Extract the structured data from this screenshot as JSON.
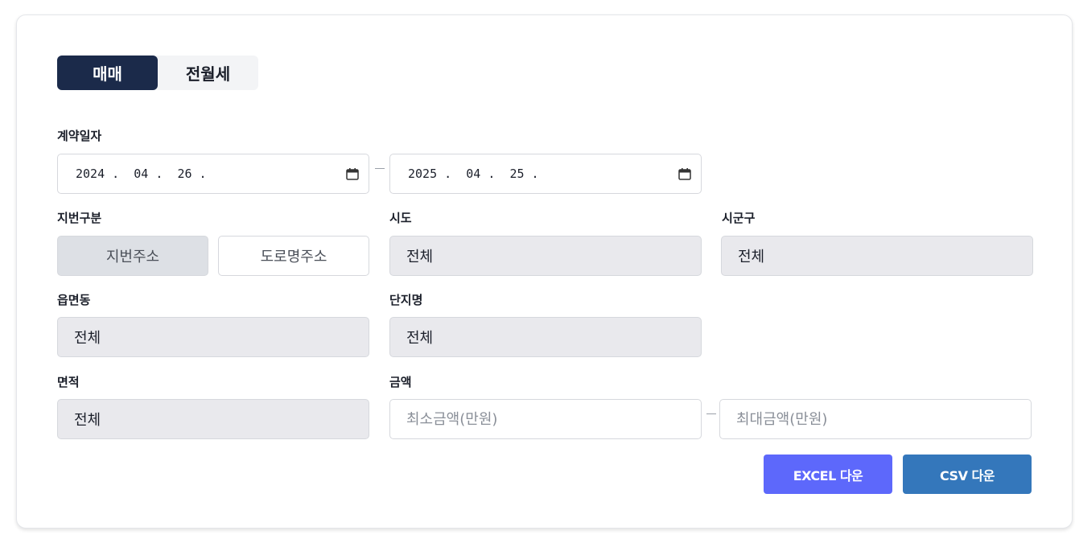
{
  "tabs": [
    {
      "label": "매매",
      "active": true
    },
    {
      "label": "전월세",
      "active": false
    }
  ],
  "contract_date": {
    "label": "계약일자",
    "start": {
      "year": "2024",
      "month": "04",
      "day": "26"
    },
    "end": {
      "year": "2025",
      "month": "04",
      "day": "25"
    }
  },
  "lot_type": {
    "label": "지번구분",
    "options": [
      {
        "label": "지번주소",
        "selected": true
      },
      {
        "label": "도로명주소",
        "selected": false
      }
    ]
  },
  "sido": {
    "label": "시도",
    "value": "전체"
  },
  "sigungu": {
    "label": "시군구",
    "value": "전체"
  },
  "eupmyeondong": {
    "label": "읍면동",
    "value": "전체"
  },
  "complex": {
    "label": "단지명",
    "value": "전체"
  },
  "area": {
    "label": "면적",
    "value": "전체"
  },
  "amount": {
    "label": "금액",
    "min_placeholder": "최소금액(만원)",
    "max_placeholder": "최대금액(만원)"
  },
  "actions": {
    "excel_label": "EXCEL 다운",
    "csv_label": "CSV 다운"
  },
  "colors": {
    "tab_active": "#1b2a4a",
    "excel_button": "#5d68fb",
    "csv_button": "#3477bb",
    "select_bg": "#e9e9ed"
  },
  "icons": {
    "date_picker": "calendar-icon"
  }
}
